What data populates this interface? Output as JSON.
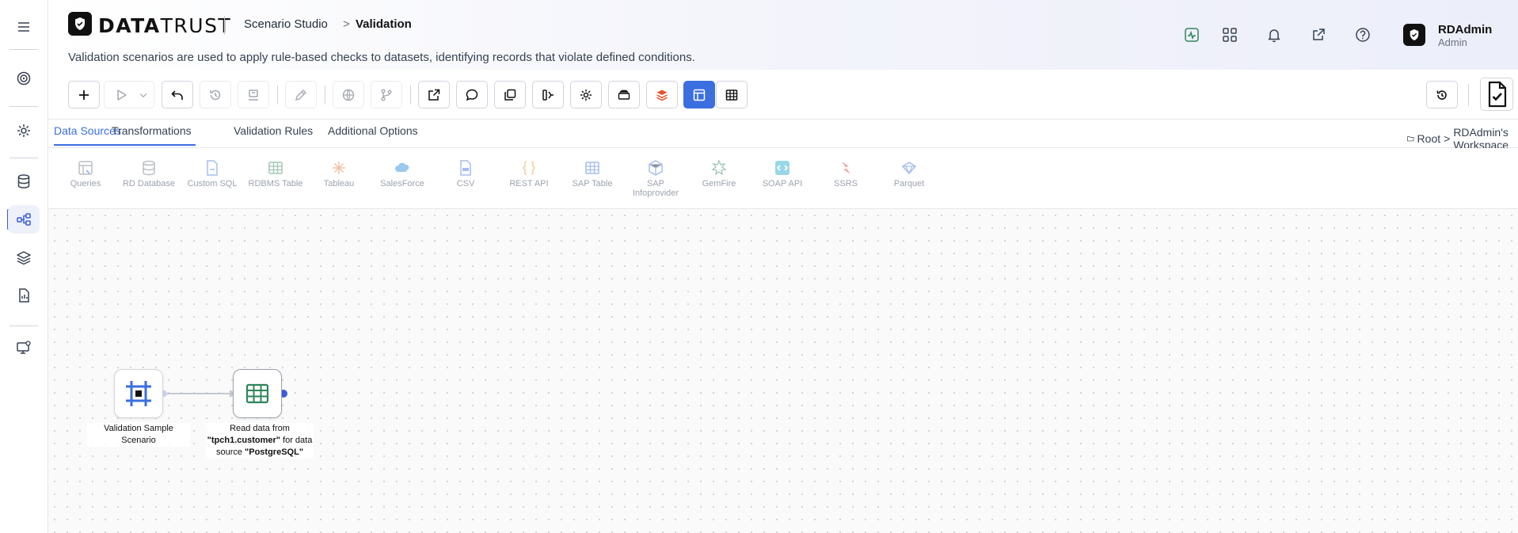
{
  "app": {
    "brand_bold": "DATA",
    "brand_light": "TRUST"
  },
  "header": {
    "breadcrumb_parent": "Scenario Studio",
    "breadcrumb_separator": ">",
    "breadcrumb_current": "Validation",
    "description": "Validation scenarios are used to apply rule-based checks to datasets, identifying records that violate defined conditions.",
    "icons": [
      "activity-icon",
      "apps-grid-icon",
      "bell-icon",
      "external-link-icon",
      "help-icon"
    ]
  },
  "user": {
    "name": "RDAdmin",
    "role": "Admin"
  },
  "rail": {
    "items": [
      "menu-icon",
      "target-icon",
      "gear-icon",
      "database-icon",
      "flow-icon",
      "layers-icon",
      "report-icon",
      "monitor-settings-icon"
    ],
    "active": "flow-icon"
  },
  "tabs": {
    "items": [
      "Data Sources",
      "Transformations",
      "Validation Rules",
      "Additional Options"
    ],
    "active": "Data Sources"
  },
  "workspace": {
    "root": "Root",
    "separator": ">",
    "name": "RDAdmin's Workspace"
  },
  "palette": {
    "items": [
      {
        "label": "Queries",
        "color": "#6b7280"
      },
      {
        "label": "RD Database",
        "color": "#6b7280"
      },
      {
        "label": "Custom SQL",
        "color": "#3b6fe0"
      },
      {
        "label": "RDBMS Table",
        "color": "#2f855a"
      },
      {
        "label": "Tableau",
        "color": "#e07b39"
      },
      {
        "label": "SalesForce",
        "color": "#1f8ad8"
      },
      {
        "label": "CSV",
        "color": "#3b6fe0"
      },
      {
        "label": "REST API",
        "color": "#e0a030"
      },
      {
        "label": "SAP Table",
        "color": "#3b6fe0"
      },
      {
        "label": "SAP Infoprovider",
        "color": "#3b6fe0"
      },
      {
        "label": "GemFire",
        "color": "#2f855a"
      },
      {
        "label": "SOAP API",
        "color": "#1fa8c8"
      },
      {
        "label": "SSRS",
        "color": "#d9463c"
      },
      {
        "label": "Parquet",
        "color": "#3b6fe0"
      }
    ]
  },
  "canvas": {
    "nodes": [
      {
        "label": "Validation Sample Scenario"
      },
      {
        "label_parts": [
          "Read data from ",
          "\"tpch1.customer\"",
          " for data source ",
          "\"PostgreSQL\""
        ]
      }
    ]
  },
  "colors": {
    "accent": "#3b6fe0",
    "activity_icon": "#2f855a"
  }
}
